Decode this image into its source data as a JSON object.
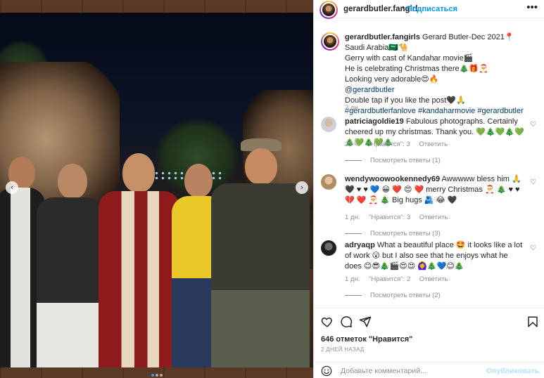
{
  "header": {
    "username": "gerardbutler.fangirl",
    "separator": "•",
    "follow_label": "Подписаться",
    "more_icon": "•••"
  },
  "caption": {
    "username": "gerardbutler.fangirls",
    "lines": [
      "Gerard Butler-Dec 2021📍Saudi Arabia🇸🇦🐪",
      "Gerry with cast of Kandahar movie🎬",
      "He is celebrating Christmas there🎄🎁🎅",
      "Looking very adorable😍🔥",
      "@gerardbutler",
      "Double tap if you like the post🖤🙏",
      "#gerardbutlerfanlove #kandaharmovie #gerardbutler"
    ],
    "time": "2 дн."
  },
  "comments": [
    {
      "username": "patriciagoldie19",
      "text": "Fabulous photographs. Certainly cheered up my christmas. Thank you. 💚🎄💚🎄💚🎄💚🎄💚🎄",
      "time": "22 ч.",
      "likes": "\"Нравится\": 3",
      "reply": "Ответить",
      "replies": "Посмотреть ответы (1)"
    },
    {
      "username": "wendywoowookennedy69",
      "text": "Awwwww bless him 🙏 🖤 ♥ ♥ 💙 😀 ❤️ 😍 ❤️ merry Christmas 🎅 🎄 ♥ ♥ 💔 ❤️ 🎅 🎄 Big hugs 🫂 😂 🖤",
      "time": "1 дн.",
      "likes": "\"Нравится\": 3",
      "reply": "Ответить",
      "replies": "Посмотреть ответы (3)"
    },
    {
      "username": "adryaqp",
      "text": "What a beautiful place 🤩 it looks like a lot of work 😮 but I also see that he enjoys what he does 😊😎🎄🎬😍😍 🙆‍♀️🎄💙😊🎄",
      "time": "1 дн.",
      "likes": "\"Нравится\": 2",
      "reply": "Ответить",
      "replies": "Посмотреть ответы (2)"
    }
  ],
  "actions": {
    "likes": "646 отметок \"Нравится\"",
    "when": "2 ДНЕЙ НАЗАД",
    "comment_placeholder": "Добавьте комментарий...",
    "publish_label": "Опубликовать"
  },
  "carousel": {
    "prev_icon": "‹",
    "next_icon": "›",
    "slide_count": 3,
    "active_slide": 1
  },
  "colors": {
    "link_blue": "#0095f6",
    "tag_blue": "#00376b",
    "muted": "#8e8e8e",
    "publish_disabled": "#b2dffc"
  }
}
